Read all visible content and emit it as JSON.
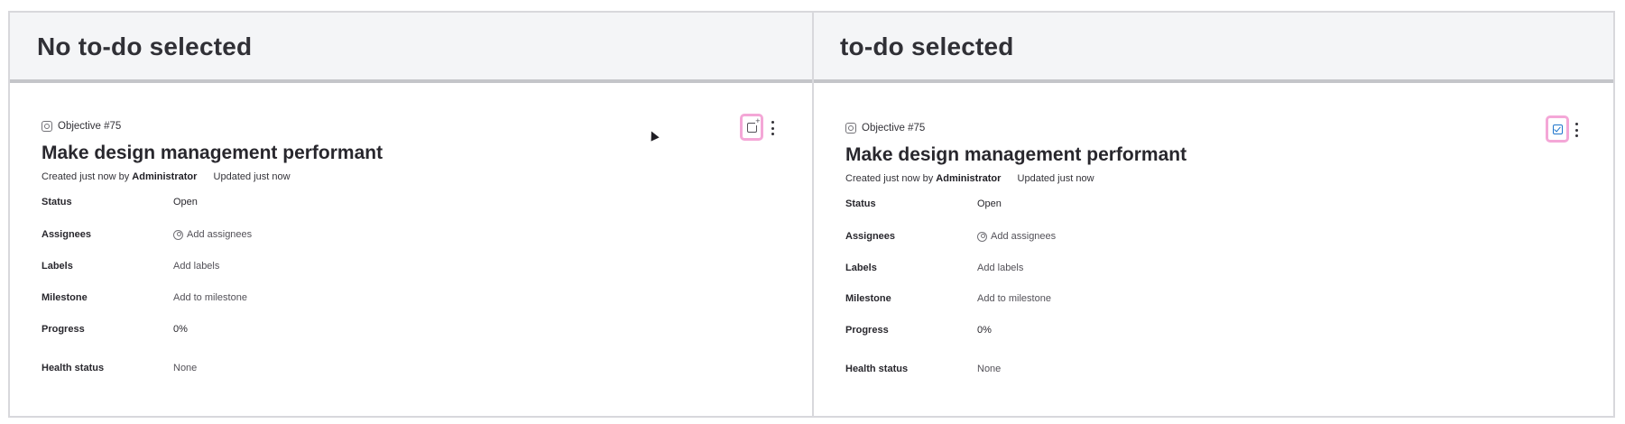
{
  "columns": [
    {
      "heading": "No to-do selected",
      "todo_state": "add",
      "objective_ref": "Objective #75",
      "title": "Make design management performant",
      "created_prefix": "Created just now by",
      "created_by": "Administrator",
      "updated": "Updated just now",
      "attributes": {
        "status": {
          "label": "Status",
          "value": "Open"
        },
        "assignees": {
          "label": "Assignees",
          "value": "Add assignees"
        },
        "labels": {
          "label": "Labels",
          "value": "Add labels"
        },
        "milestone": {
          "label": "Milestone",
          "value": "Add to milestone"
        },
        "progress": {
          "label": "Progress",
          "value": "0%"
        },
        "health": {
          "label": "Health status",
          "value": "None"
        }
      }
    },
    {
      "heading": "to-do selected",
      "todo_state": "done",
      "objective_ref": "Objective #75",
      "title": "Make design management performant",
      "created_prefix": "Created just now by",
      "created_by": "Administrator",
      "updated": "Updated just now",
      "attributes": {
        "status": {
          "label": "Status",
          "value": "Open"
        },
        "assignees": {
          "label": "Assignees",
          "value": "Add assignees"
        },
        "labels": {
          "label": "Labels",
          "value": "Add labels"
        },
        "milestone": {
          "label": "Milestone",
          "value": "Add to milestone"
        },
        "progress": {
          "label": "Progress",
          "value": "0%"
        },
        "health": {
          "label": "Health status",
          "value": "None"
        }
      }
    }
  ],
  "colors": {
    "highlight": "#f4a7d7",
    "todo_done": "#1f75cb",
    "header_bg": "#f4f5f7"
  }
}
